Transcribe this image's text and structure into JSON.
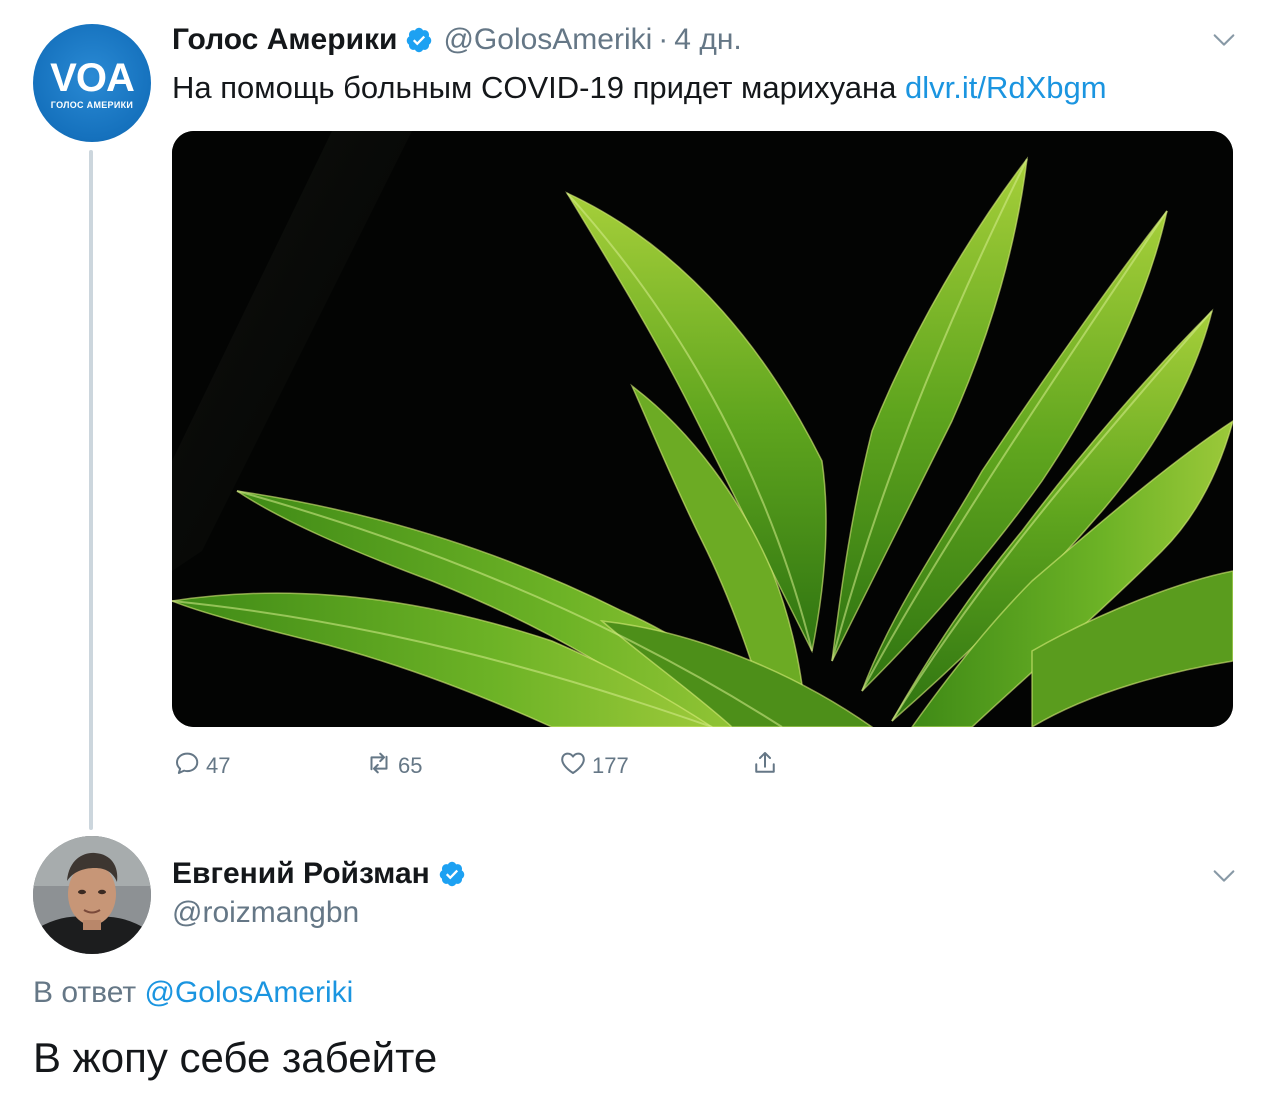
{
  "colors": {
    "link": "#1b95e0",
    "muted": "#657786",
    "text": "#14171a",
    "verified": "#1da1f2",
    "thread_line": "#ccd6dd"
  },
  "tweet": {
    "author": {
      "avatar_logo": "VOA",
      "avatar_caption": "ГОЛОС АМЕРИКИ",
      "display_name": "Голос Америки",
      "verified_icon": "verified-badge-icon",
      "handle": "@GolosAmeriki",
      "separator": "·",
      "time": "4 дн."
    },
    "text": "На помощь больным COVID-19 придет марихуана",
    "link": "dlvr.it/RdXbgm",
    "media": {
      "description_icon": "cannabis-leaf-photo"
    },
    "actions": {
      "reply": {
        "icon": "reply-icon",
        "count": "47"
      },
      "retweet": {
        "icon": "retweet-icon",
        "count": "65"
      },
      "like": {
        "icon": "heart-icon",
        "count": "177"
      },
      "share": {
        "icon": "share-icon"
      }
    },
    "menu_icon": "chevron-down-icon"
  },
  "reply": {
    "author": {
      "display_name": "Евгений Ройзман",
      "verified_icon": "verified-badge-icon",
      "handle": "@roizmangbn"
    },
    "replying_to_prefix": "В ответ",
    "replying_to_handle": "@GolosAmeriki",
    "text": "В жопу себе забейте",
    "menu_icon": "chevron-down-icon"
  }
}
